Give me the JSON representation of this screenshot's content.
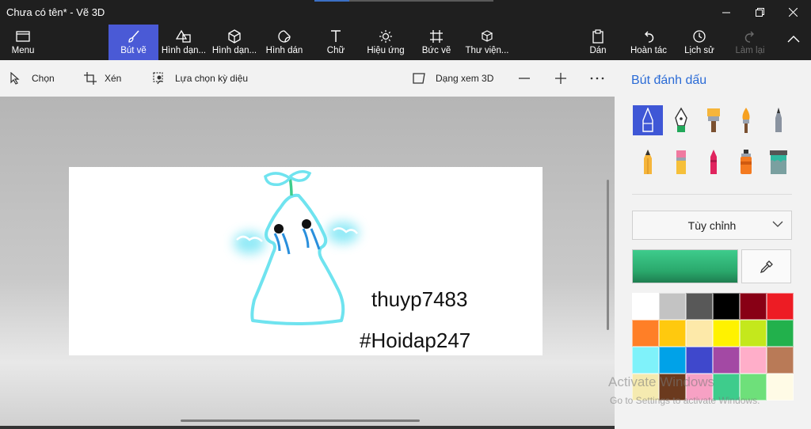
{
  "window": {
    "title": "Chưa có tên* - Vẽ 3D",
    "controls": {
      "minimize": "minimize-icon",
      "restore": "restore-icon",
      "close": "close-icon"
    }
  },
  "ribbon": {
    "menu": "Menu",
    "brushes": "Bút vẽ",
    "shapes_2d": "Hình dạn...",
    "shapes_3d": "Hình dạn...",
    "stickers": "Hình dán",
    "text": "Chữ",
    "effects": "Hiệu ứng",
    "canvas": "Bức vẽ",
    "library": "Thư viện...",
    "paste": "Dán",
    "undo": "Hoàn tác",
    "history": "Lịch sử",
    "redo": "Làm lại"
  },
  "toolbar": {
    "select": "Chọn",
    "crop": "Xén",
    "magic_select": "Lựa chọn kỳ diệu",
    "view_3d": "Dạng xem 3D"
  },
  "canvas": {
    "text_line1": "thuyp7483",
    "text_line2": "#Hoidap247"
  },
  "panel": {
    "title": "Bút đánh dấu",
    "brushes": [
      "marker",
      "calligraphy-pen",
      "oil-brush",
      "watercolor",
      "pixel-pen",
      "pencil",
      "eraser",
      "crayon",
      "spray-can",
      "fill-bucket"
    ],
    "selected_brush": "marker",
    "dropdown": "Tùy chỉnh",
    "current_color": "#3ecc8c",
    "palette": [
      "#ffffff",
      "#c3c3c3",
      "#585858",
      "#000000",
      "#880015",
      "#ed1c24",
      "#ff7f27",
      "#ffc90e",
      "#fde9a9",
      "#fff200",
      "#c4e81c",
      "#22b14c",
      "#7ff2fa",
      "#00a2e8",
      "#3f48cc",
      "#a349a4",
      "#ffaec9",
      "#b97a57",
      "#f5eab0",
      "#6b3a1e",
      "#f7a1c4",
      "#3ecc8c",
      "#6ee07a",
      "#fffbe6"
    ]
  },
  "watermark": {
    "line1": "Activate Windows",
    "line2": "Go to Settings to activate Windows."
  },
  "colors": {
    "accent": "#4a5ad6",
    "panel_title": "#2b6bd6",
    "stroke": "#6fe3ef"
  }
}
